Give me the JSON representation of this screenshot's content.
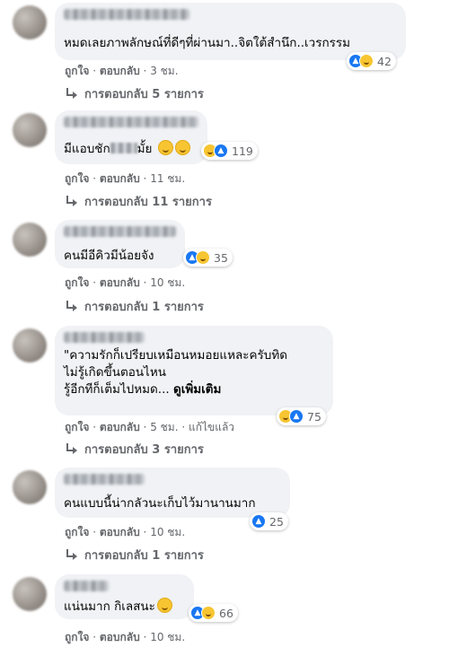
{
  "comments": [
    {
      "text": "หมดเลยภาพลักษณ์ที่ดีๆที่ผ่านมา..จิตใต้สำนึก..เวรกรรม",
      "reaction_count": "42",
      "like_label": "ถูกใจ",
      "reply_label": "ตอบกลับ",
      "time": "3 ชม.",
      "replies_label": "การตอบกลับ 5 รายการ"
    },
    {
      "text_before": "มีแอบชัก",
      "text_after": "มั้ย",
      "reaction_count": "119",
      "like_label": "ถูกใจ",
      "reply_label": "ตอบกลับ",
      "time": "11 ชม.",
      "replies_label": "การตอบกลับ 11 รายการ"
    },
    {
      "text": "คนมีอีคิวมีน้อยจัง",
      "reaction_count": "35",
      "like_label": "ถูกใจ",
      "reply_label": "ตอบกลับ",
      "time": "10 ชม.",
      "replies_label": "การตอบกลับ 1 รายการ"
    },
    {
      "line1": "\"ความรักก็เปรียบเหมือนหมอยแหละครับทิด",
      "line2": "ไม่รู้เกิดขึ้นตอนไหน",
      "line3": "รู้อีกทีก็เต็มไปหมด...",
      "see_more": "ดูเพิ่มเติม",
      "reaction_count": "75",
      "like_label": "ถูกใจ",
      "reply_label": "ตอบกลับ",
      "time": "5 ชม.",
      "edited": "แก้ไขแล้ว",
      "replies_label": "การตอบกลับ 3 รายการ"
    },
    {
      "text": "คนแบบนี้น่ากลัวนะเก็บไว้มานานมาก",
      "reaction_count": "25",
      "like_label": "ถูกใจ",
      "reply_label": "ตอบกลับ",
      "time": "10 ชม.",
      "replies_label": "การตอบกลับ 1 รายการ"
    },
    {
      "text": "แน่นมาก กิเลสนะ",
      "reaction_count": "66",
      "like_label": "ถูกใจ",
      "reply_label": "ตอบกลับ",
      "time": "10 ชม."
    }
  ],
  "colors": {
    "bubble": "#f0f2f5",
    "meta_text": "#65676b",
    "like_blue": "#1877f2",
    "haha_yellow": "#f7c531"
  },
  "icons": {
    "like": "thumbs-up-icon",
    "haha": "laughing-face-icon",
    "reply": "reply-arrow-icon"
  }
}
